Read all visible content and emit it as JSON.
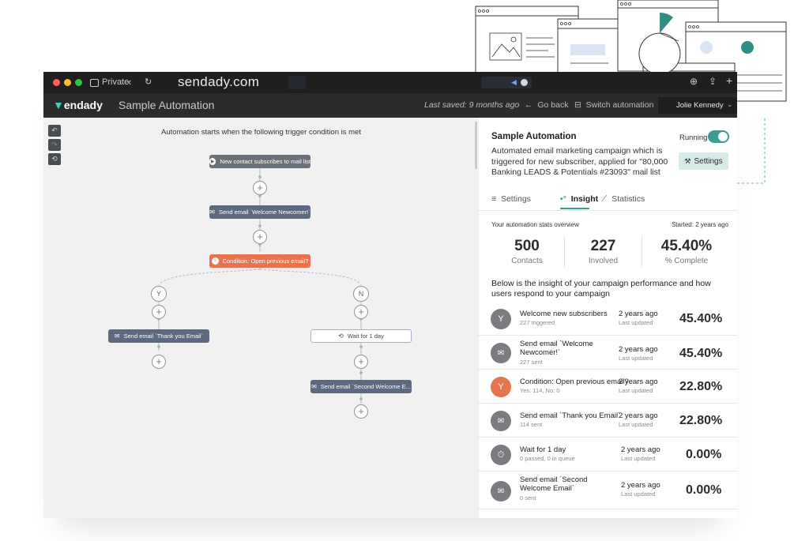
{
  "browser": {
    "private_label": "Private",
    "url": "sendady.com",
    "colors": {
      "close": "#ff5f57",
      "minimize": "#febc2e",
      "zoom": "#28c840"
    }
  },
  "app": {
    "logo_text": "endady",
    "title": "Sample Automation",
    "last_saved": "Last saved: 9 months ago",
    "go_back": "Go back",
    "switch_automation": "Switch automation",
    "user_name": "Jolie Kennedy"
  },
  "workflow": {
    "heading": "Automation starts when the following trigger condition is met",
    "trigger": "New contact subscribes to mail list",
    "send_welcome": "Send email `Welcome Newcomer!`",
    "condition": "Condition: Open previous email?",
    "yes_label": "Y",
    "no_label": "N",
    "send_thankyou": "Send email `Thank you Email`",
    "wait": "Wait for 1 day",
    "send_second": "Send email `Second Welcome E...",
    "plus": "+"
  },
  "panel": {
    "title": "Sample Automation",
    "status": "Running",
    "description": "Automated email marketing campaign which is triggered for new subscriber, applied for \"80,000 Banking LEADS & Potentials #23093\" mail list",
    "settings_button": "Settings",
    "tabs": [
      "Settings",
      "Insight",
      "Statistics"
    ],
    "active_tab": "Insight",
    "overview_label": "Your automation stats overview",
    "started": "Started: 2 years ago",
    "stats": [
      {
        "value": "500",
        "label": "Contacts"
      },
      {
        "value": "227",
        "label": "Involved"
      },
      {
        "value": "45.40%",
        "label": "% Complete"
      }
    ],
    "insight_text": "Below is the insight of your campaign performance and how users respond to your campaign",
    "rows": [
      {
        "title": "Welcome new subscribers",
        "sub": "227 triggered",
        "when": "2 years ago",
        "updated": "Last updated",
        "pct": "45.40%",
        "icon": "fork-icon"
      },
      {
        "title": "Send email `Welcome Newcomer!`",
        "sub": "227 sent",
        "when": "2 years ago",
        "updated": "Last updated",
        "pct": "45.40%",
        "icon": "envelope-icon"
      },
      {
        "title": "Condition: Open previous email?",
        "sub": "Yes: 114, No: 0",
        "when": "2 years ago",
        "updated": "Last updated",
        "pct": "22.80%",
        "icon": "branch-icon"
      },
      {
        "title": "Send email `Thank you Email`",
        "sub": "114 sent",
        "when": "2 years ago",
        "updated": "Last updated",
        "pct": "22.80%",
        "icon": "envelope-icon"
      },
      {
        "title": "Wait for 1 day",
        "sub": "0 passed, 0 in queue",
        "when": "2 years ago",
        "updated": "Last updated",
        "pct": "0.00%",
        "icon": "stopwatch-icon"
      },
      {
        "title": "Send email `Second Welcome Email`",
        "sub": "0 sent",
        "when": "2 years ago",
        "updated": "Last updated",
        "pct": "0.00%",
        "icon": "envelope-icon"
      }
    ]
  },
  "colors": {
    "accent_teal": "#3a9d92",
    "orange": "#e8744f",
    "slate": "#5d6981",
    "settings_bg": "#d7ece8"
  }
}
